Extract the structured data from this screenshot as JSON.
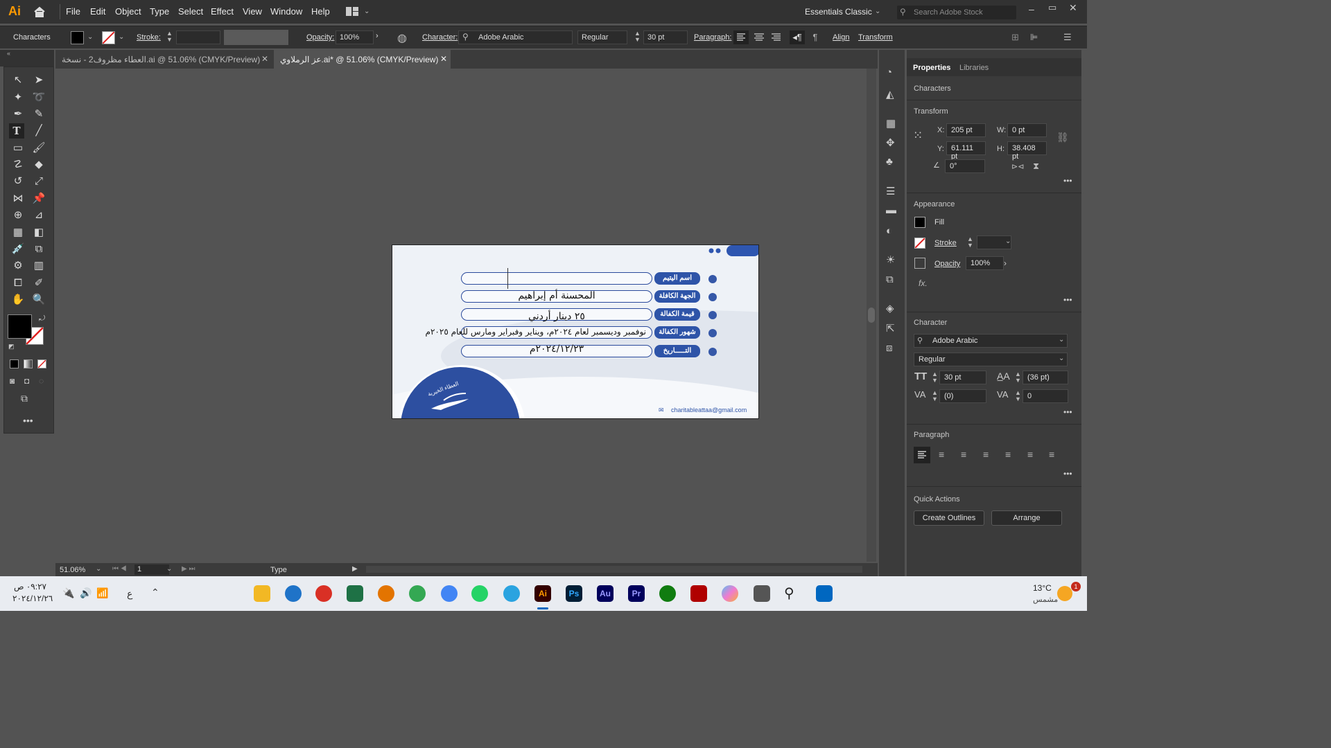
{
  "app": {
    "logo": "Ai",
    "menus": [
      "File",
      "Edit",
      "Object",
      "Type",
      "Select",
      "Effect",
      "View",
      "Window",
      "Help"
    ],
    "workspace": "Essentials Classic",
    "search_placeholder": "Search Adobe Stock"
  },
  "control": {
    "panel_name": "Characters",
    "stroke_label": "Stroke:",
    "opacity_label": "Opacity:",
    "opacity_value": "100%",
    "character_label": "Character:",
    "font": "Adobe Arabic",
    "style": "Regular",
    "size": "30 pt",
    "paragraph_label": "Paragraph:",
    "align_label": "Align",
    "transform_label": "Transform"
  },
  "tabs": [
    {
      "label": "العطاء مظروف2 - نسخة.ai @ 51.06% (CMYK/Preview)",
      "active": false
    },
    {
      "label": "عز الرملاوي.ai* @ 51.06% (CMYK/Preview)",
      "active": true
    }
  ],
  "artboard": {
    "rows": [
      {
        "label": "اسم اليتيم",
        "value": ""
      },
      {
        "label": "الجهة الكافلة",
        "value": "المحسنة أم إبراهيم"
      },
      {
        "label": "قيمة الكفالة",
        "value": "٢٥ دينار أردني"
      },
      {
        "label": "شهور الكفالة",
        "value": "نوفمبر وديسمبر لعام ٢٠٢٤م، ويناير وفبراير ومارس للعام ٢٠٢٥م"
      },
      {
        "label": "التـــــاريخ",
        "value": "٢٠٢٤/١٢/٢٣م"
      }
    ],
    "logo_text": "العطاء الخيرية",
    "email": "charitableattaa@gmail.com"
  },
  "properties": {
    "tabs": [
      "Properties",
      "Libraries"
    ],
    "selection": "Characters",
    "transform_title": "Transform",
    "x": "205 pt",
    "y": "61.111 pt",
    "w": "0 pt",
    "h": "38.408 pt",
    "angle": "0°",
    "x_label": "X:",
    "y_label": "Y:",
    "w_label": "W:",
    "h_label": "H:",
    "appearance_title": "Appearance",
    "fill_label": "Fill",
    "stroke_label": "Stroke",
    "opacity_label": "Opacity",
    "opacity_value": "100%",
    "fx": "fx.",
    "character_title": "Character",
    "font": "Adobe Arabic",
    "style": "Regular",
    "size": "30 pt",
    "leading": "(36 pt)",
    "kerning": "(0)",
    "tracking": "0",
    "paragraph_title": "Paragraph",
    "quick_actions_title": "Quick Actions",
    "create_outlines": "Create Outlines",
    "arrange": "Arrange"
  },
  "status": {
    "zoom": "51.06%",
    "page": "1",
    "tool": "Type"
  },
  "taskbar": {
    "time": "٠٩:٢٧ ص",
    "date": "٢٠٢٤/١٢/٢٦",
    "lang": "ع",
    "weather_temp": "13°C",
    "weather_text": "مشمس",
    "notif_count": "1"
  }
}
